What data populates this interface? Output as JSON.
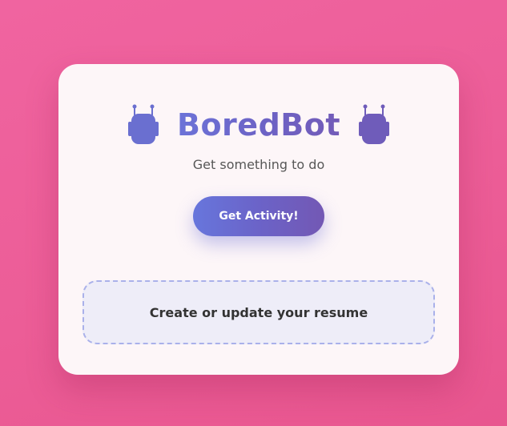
{
  "app": {
    "title": "BoredBot",
    "subtitle": "Get something to do",
    "icon": "robot-icon"
  },
  "actions": {
    "get_activity_label": "Get Activity!"
  },
  "result": {
    "activity": "Create or update your resume"
  },
  "colors": {
    "background": "#ef5f9b",
    "card": "#fdf6f8",
    "accent_start": "#6776dc",
    "accent_end": "#7358b4",
    "result_border": "#aab1ea",
    "result_background": "#eeedf8"
  }
}
